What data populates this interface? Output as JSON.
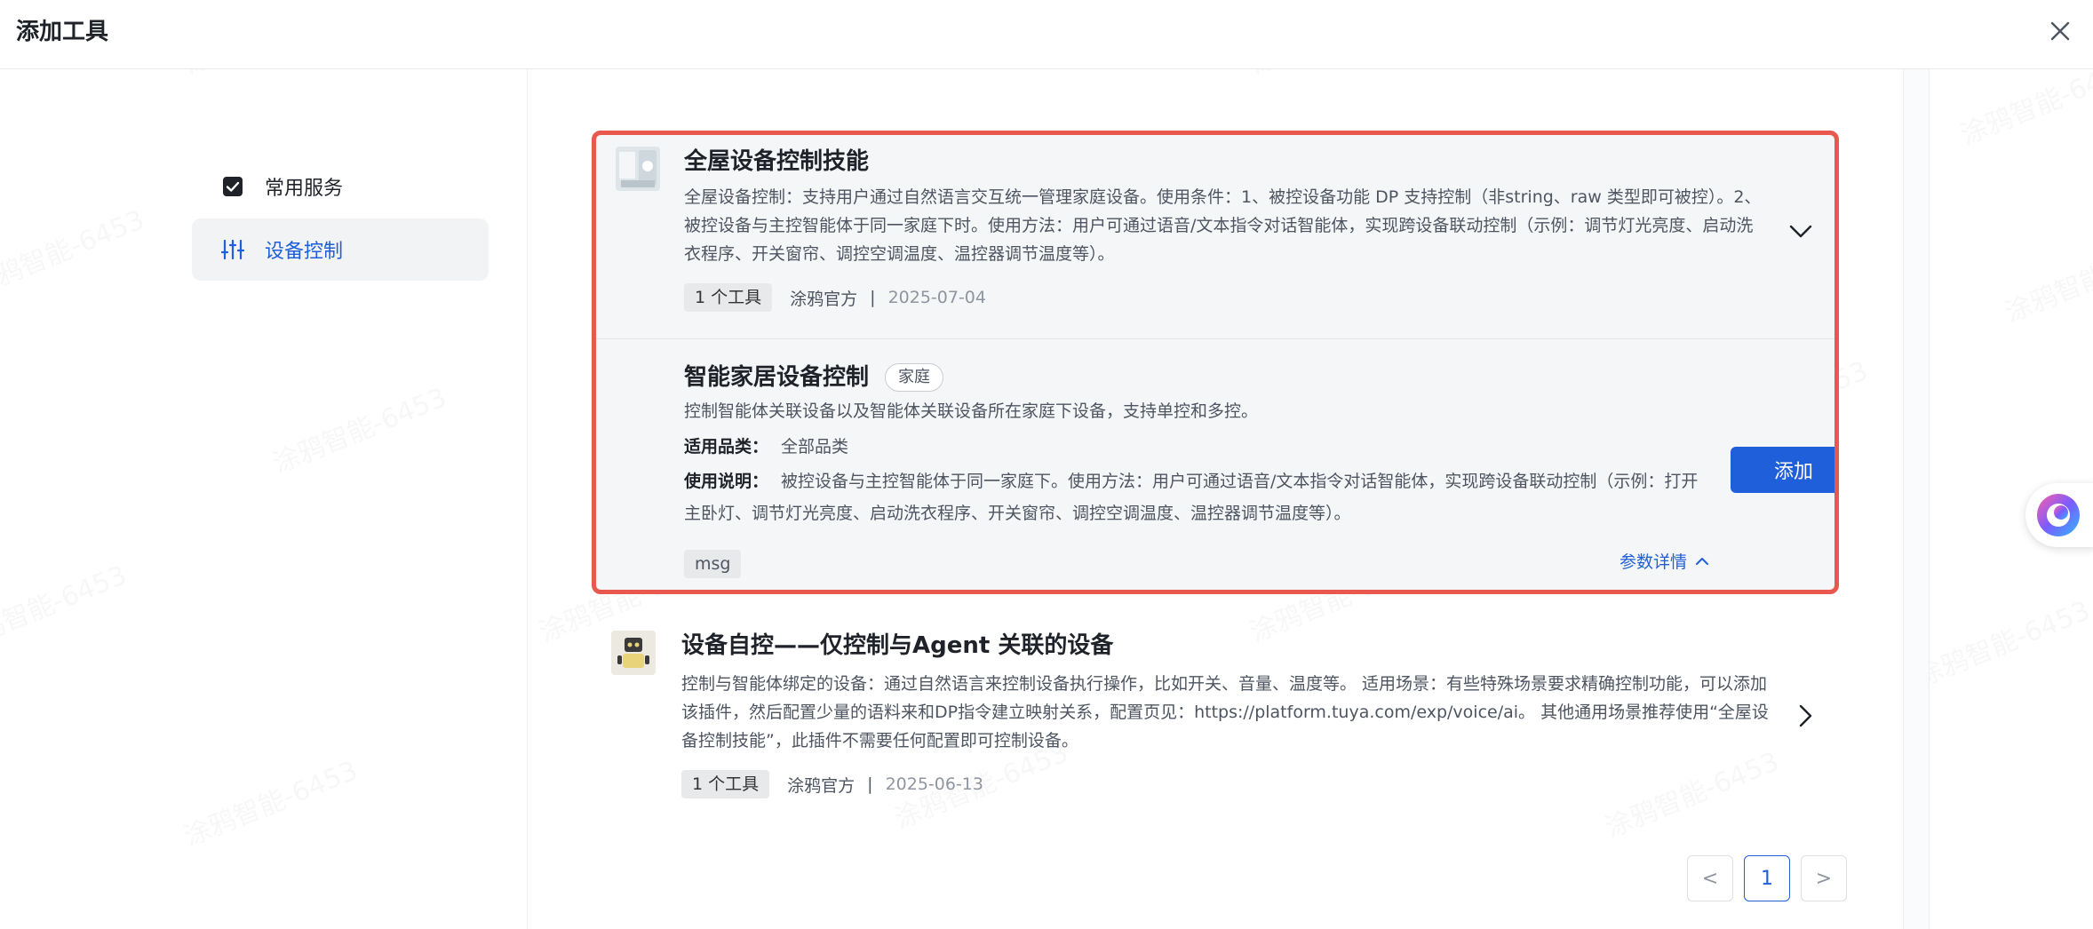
{
  "header": {
    "title": "添加工具"
  },
  "sidebar": {
    "items": [
      {
        "label": "常用服务",
        "icon": "checkbox-checked-icon",
        "checked": true
      },
      {
        "label": "设备控制",
        "icon": "sliders-icon",
        "active": true
      }
    ]
  },
  "tools": [
    {
      "title": "全屋设备控制技能",
      "description": "全屋设备控制：支持用户通过自然语言交互统一管理家庭设备。使用条件：1、被控设备功能 DP 支持控制（非string、raw 类型即可被控）。2、被控设备与主控智能体于同一家庭下时。使用方法：用户可通过语音/文本指令对话智能体，实现跨设备联动控制（示例：调节灯光亮度、启动洗衣程序、开关窗帘、调控空调温度、温控器调节温度等）。",
      "tool_count": "1 个工具",
      "author": "涂鸦官方",
      "separator": "|",
      "date": "2025-07-04",
      "expanded": true,
      "sub_tool": {
        "title": "智能家居设备控制",
        "tag": "家庭",
        "description": "控制智能体关联设备以及智能体关联设备所在家庭下设备，支持单控和多控。",
        "category_label": "适用品类：",
        "category_value": "全部品类",
        "usage_label": "使用说明：",
        "usage_value": "被控设备与主控智能体于同一家庭下。使用方法：用户可通过语音/文本指令对话智能体，实现跨设备联动控制（示例：打开主卧灯、调节灯光亮度、启动洗衣程序、开关窗帘、调控空调温度、温控器调节温度等）。",
        "param_tag": "msg",
        "param_link": "参数详情",
        "add_label": "添加"
      }
    },
    {
      "title": "设备自控——仅控制与Agent 关联的设备",
      "description": "控制与智能体绑定的设备：通过自然语言来控制设备执行操作，比如开关、音量、温度等。 适用场景：有些特殊场景要求精确控制功能，可以添加该插件，然后配置少量的语料来和DP指令建立映射关系，配置页见：https://platform.tuya.com/exp/voice/ai。 其他通用场景推荐使用“全屋设备控制技能”，此插件不需要任何配置即可控制设备。",
      "tool_count": "1 个工具",
      "author": "涂鸦官方",
      "separator": "|",
      "date": "2025-06-13"
    }
  ],
  "pagination": {
    "prev": "<",
    "current": "1",
    "next": ">"
  },
  "watermark": "涂鸦智能-6453",
  "colors": {
    "accent": "#1f5fd9",
    "highlight_border": "#e8584f"
  }
}
